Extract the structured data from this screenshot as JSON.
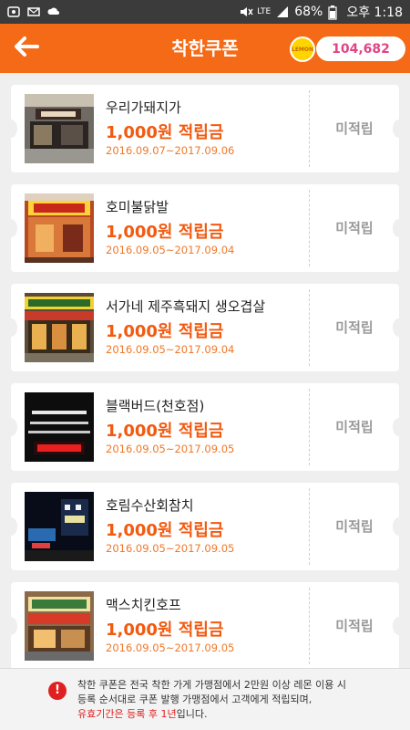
{
  "status_bar": {
    "battery": "68%",
    "time": "오후 1:18",
    "network": "LTE"
  },
  "header": {
    "title": "착한쿠폰",
    "lemon_label": "LEMON",
    "points": "104,682"
  },
  "coupons": [
    {
      "name": "우리가돼지가",
      "amount": "1,000원 적립금",
      "period": "2016.09.07~2017.09.06",
      "status": "미적립",
      "thumb_color": "#5a4a3a"
    },
    {
      "name": "호미불닭발",
      "amount": "1,000원 적립금",
      "period": "2016.09.05~2017.09.04",
      "status": "미적립",
      "thumb_color": "#8a3a1a"
    },
    {
      "name": "서가네 제주흑돼지 생오겹살",
      "amount": "1,000원 적립금",
      "period": "2016.09.05~2017.09.04",
      "status": "미적립",
      "thumb_color": "#6a4a2a"
    },
    {
      "name": "블랙버드(천호점)",
      "amount": "1,000원 적립금",
      "period": "2016.09.05~2017.09.05",
      "status": "미적립",
      "thumb_color": "#151515"
    },
    {
      "name": "호림수산회참치",
      "amount": "1,000원 적립금",
      "period": "2016.09.05~2017.09.05",
      "status": "미적립",
      "thumb_color": "#0c1420"
    },
    {
      "name": "맥스치킨호프",
      "amount": "1,000원 적립금",
      "period": "2016.09.05~2017.09.05",
      "status": "미적립",
      "thumb_color": "#7a5a3a"
    }
  ],
  "notice": {
    "line1": "착한 쿠폰은 전국 착한 가게 가맹점에서 2만원 이상 레몬 이용 시",
    "line2": "등록 순서대로 쿠폰 발행 가맹점에서 고객에게 적립되며,",
    "line3_red": "유효기간은 등록 후 1년",
    "line3_rest": "입니다."
  },
  "colors": {
    "brand": "#f46a17",
    "points": "#e24484",
    "amount": "#f25a10",
    "alert": "#e02020"
  },
  "icons": {
    "back": "arrow-left-icon",
    "notice": "exclamation-icon"
  }
}
